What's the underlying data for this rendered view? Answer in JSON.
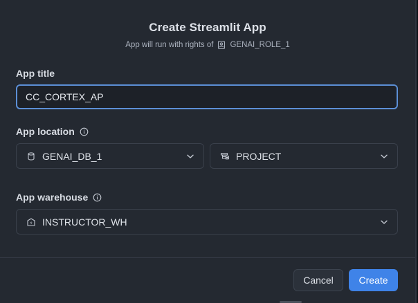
{
  "dialog": {
    "title": "Create Streamlit App",
    "subtitle_prefix": "App will run with rights of",
    "role_name": "GENAI_ROLE_1",
    "role_icon": "user-badge-icon"
  },
  "fields": {
    "app_title": {
      "label": "App title",
      "value": "CC_CORTEX_AP"
    },
    "app_location": {
      "label": "App location",
      "info_icon": "info-icon",
      "database": {
        "value": "GENAI_DB_1",
        "icon": "database-icon"
      },
      "schema": {
        "value": "PROJECT",
        "icon": "schema-icon"
      }
    },
    "app_warehouse": {
      "label": "App warehouse",
      "info_icon": "info-icon",
      "warehouse": {
        "value": "INSTRUCTOR_WH",
        "icon": "warehouse-icon"
      }
    }
  },
  "footer": {
    "cancel_label": "Cancel",
    "create_label": "Create"
  },
  "colors": {
    "dialog_bg": "#242931",
    "focus_border": "#5c8fd6",
    "primary": "#3f83e8"
  }
}
